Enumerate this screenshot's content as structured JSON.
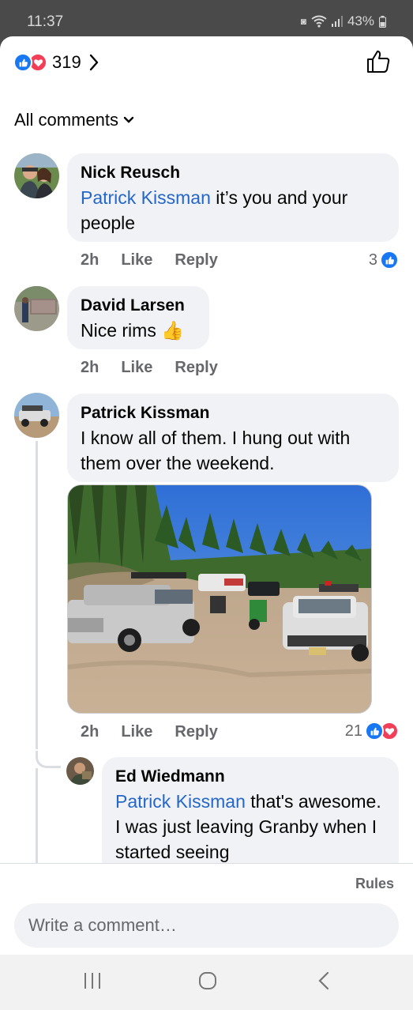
{
  "status_bar": {
    "time": "11:37",
    "battery": "43%"
  },
  "header": {
    "reaction_count": "319"
  },
  "filter": {
    "label": "All comments"
  },
  "comments": [
    {
      "author": "Nick Reusch",
      "mention": "Patrick Kissman",
      "text": " it’s you and your people",
      "time": "2h",
      "like": "Like",
      "reply": "Reply",
      "reactions": "3"
    },
    {
      "author": "David Larsen",
      "text": "Nice rims",
      "emoji": "👍",
      "time": "2h",
      "like": "Like",
      "reply": "Reply"
    },
    {
      "author": "Patrick Kissman",
      "text": "I know all of them. I hung out with them over the weekend.",
      "time": "2h",
      "like": "Like",
      "reply": "Reply",
      "reactions": "21"
    }
  ],
  "reply": {
    "author": "Ed Wiedmann",
    "mention": "Patrick Kissman",
    "text": " that's awesome.  I was just leaving Granby when I started seeing"
  },
  "footer": {
    "rules": "Rules",
    "placeholder": "Write a comment…"
  },
  "colors": {
    "like_blue": "#1877f2",
    "love_red": "#f33e58",
    "mention_blue": "#2467c8",
    "bubble_bg": "#f0f2f5"
  }
}
